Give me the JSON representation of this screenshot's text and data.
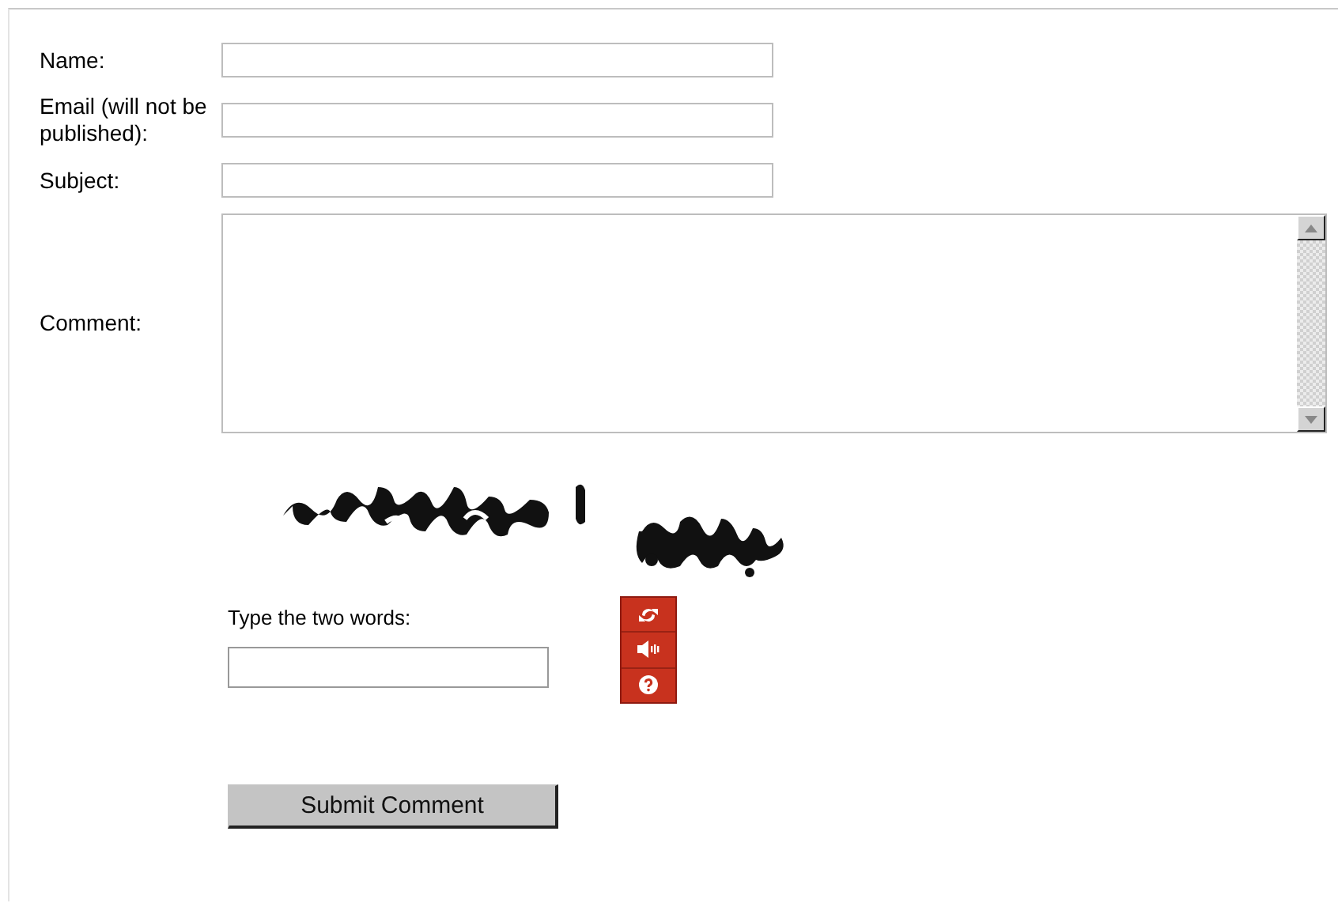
{
  "fields": [
    {
      "label": "Name:",
      "kind": "text"
    },
    {
      "label": "Email (will not be published):",
      "kind": "text"
    },
    {
      "label": "Subject:",
      "kind": "text"
    },
    {
      "label": "Comment:",
      "kind": "textarea"
    }
  ],
  "captcha": {
    "prompt": "Type the two words:"
  },
  "submit_button": "Submit Comment"
}
